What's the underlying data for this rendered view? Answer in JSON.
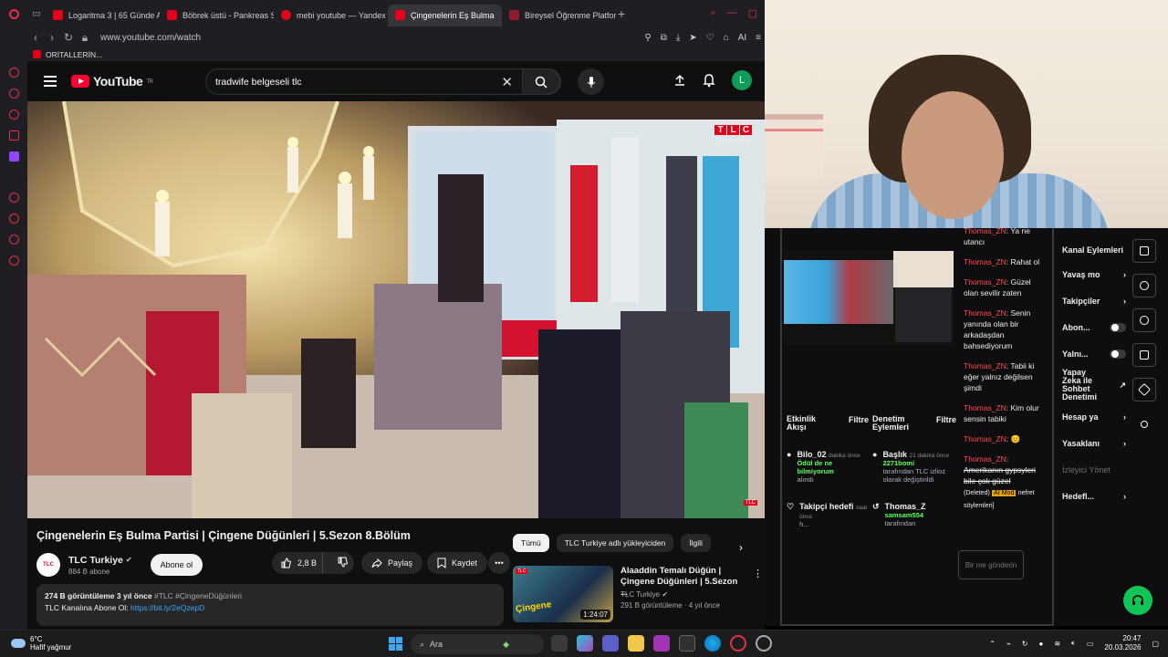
{
  "browser": {
    "tabs": [
      {
        "label": "Logaritma 3 | 65 Günde AYT",
        "color": "#e4001b",
        "active": false
      },
      {
        "label": "Böbrek üstü - Pankreas S",
        "color": "#e4001b",
        "active": false
      },
      {
        "label": "mebi youtube — Yandex",
        "color": "#e4001b",
        "active": false
      },
      {
        "label": "Çingenelerin Eş Bulma",
        "color": "#e4001b",
        "active": true
      },
      {
        "label": "Bireysel Öğrenme Platform",
        "color": "#8e1b2b",
        "active": false
      }
    ],
    "url": "www.youtube.com/watch",
    "bookmark": "ORİTALLERİN...",
    "ai_label": "AI"
  },
  "youtube": {
    "logo_text": "YouTube",
    "region": "TR",
    "search_query": "tradwife belgeseli tlc",
    "avatar_letter": "L",
    "video": {
      "title": "Çingenelerin Eş Bulma Partisi | Çingene Düğünleri | 5.Sezon 8.Bölüm",
      "tlc_sub": "TLCTV.COM.TR",
      "tlc_small": "TLC"
    },
    "channel": {
      "name": "TLC Turkiye",
      "subs": "884 B abone",
      "logo": "TLC",
      "subscribe_label": "Abone ol"
    },
    "actions": {
      "likes": "2,8 B",
      "share": "Paylaş",
      "save": "Kaydet"
    },
    "description": {
      "stats": "274 B görüntüleme  3 yıl önce",
      "tags": "#TLC #ÇingeneDüğünleri",
      "line2_prefix": "TLC Kanalına Abone Ol: ",
      "link": "https://bit.ly/2eQzepD"
    },
    "chips": [
      "Tümü",
      "TLC Turkiye adlı yükleyiciden",
      "İlgili"
    ],
    "related": {
      "title": "Alaaddin Temalı Düğün | Çingene Düğünleri | 5.Sezon ...",
      "channel": "TLC Turkiye",
      "meta": "291 B görüntüleme · 4 yıl önce",
      "duration": "1:24:07",
      "thumb_logo": "TLC",
      "thumb_text": "Çingene"
    }
  },
  "stream": {
    "chat": [
      {
        "user": "Thomas_ZN",
        "text": ": Ya ne utancı"
      },
      {
        "user": "Thomas_ZN",
        "text": ": Rahat ol"
      },
      {
        "user": "Thomas_ZN",
        "text": ": Güzel olan sevilir zaten"
      },
      {
        "user": "Thomas_ZN",
        "text": ": Senin yanında olan bir arkadaşdan bahsediyorum"
      },
      {
        "user": "Thomas_ZN",
        "text": ": Tabii ki eğer yalnız değilsen şimdi"
      },
      {
        "user": "Thomas_ZN",
        "text": ": Kim olur sensin tabiki"
      },
      {
        "user": "Thomas_ZN",
        "text": ": 😊"
      },
      {
        "user": "Thomas_ZN",
        "text": ":"
      }
    ],
    "deleted_msg": "Amerikanın gypsyleri bile çok güzel",
    "deleted_tag": "(Deleted)",
    "ai_mod": "AI Mod",
    "deleted_reason": "nefret söylemleri]",
    "chat_placeholder": "Bir me gönderin",
    "activity": {
      "title": "Etkinlik Akışı",
      "filter": "Filtre",
      "ev1_user": "Bilo_02",
      "ev1_time": "dakika önce",
      "ev1_text": "Ödül de ne bilmiyorum",
      "ev1_sub": "alındı",
      "ev2_user": "Takipçi hedefi",
      "ev2_time": "saat önce",
      "ev2_sub": "h..."
    },
    "modlog": {
      "title": "Denetim Eylemleri",
      "filter": "Filtre",
      "ev1_user": "Başlık",
      "ev1_time": "21 dakika önce",
      "ev1_actor": "2271bomi",
      "ev1_text": "tarafından TLC izlioz olarak değiştirildi",
      "ev2_user": "Thomas_Z",
      "ev2_actor": "samsam554",
      "ev2_text": "tarafından"
    },
    "channel_actions": {
      "title": "Kanal Eylemleri",
      "items": [
        "Yavaş mo",
        "Takipçiler",
        "Abon...",
        "Yalnı...",
        "Yapay Zeka ile Sohbet Denetimi",
        "Hesap ya",
        "Yasaklanı",
        "İzleyici Yönet",
        "Hedefl..."
      ]
    }
  },
  "taskbar": {
    "temp": "6°C",
    "weather": "Hafif yağmur",
    "search": "Ara",
    "time": "20:47",
    "date": "20.03.2026"
  }
}
